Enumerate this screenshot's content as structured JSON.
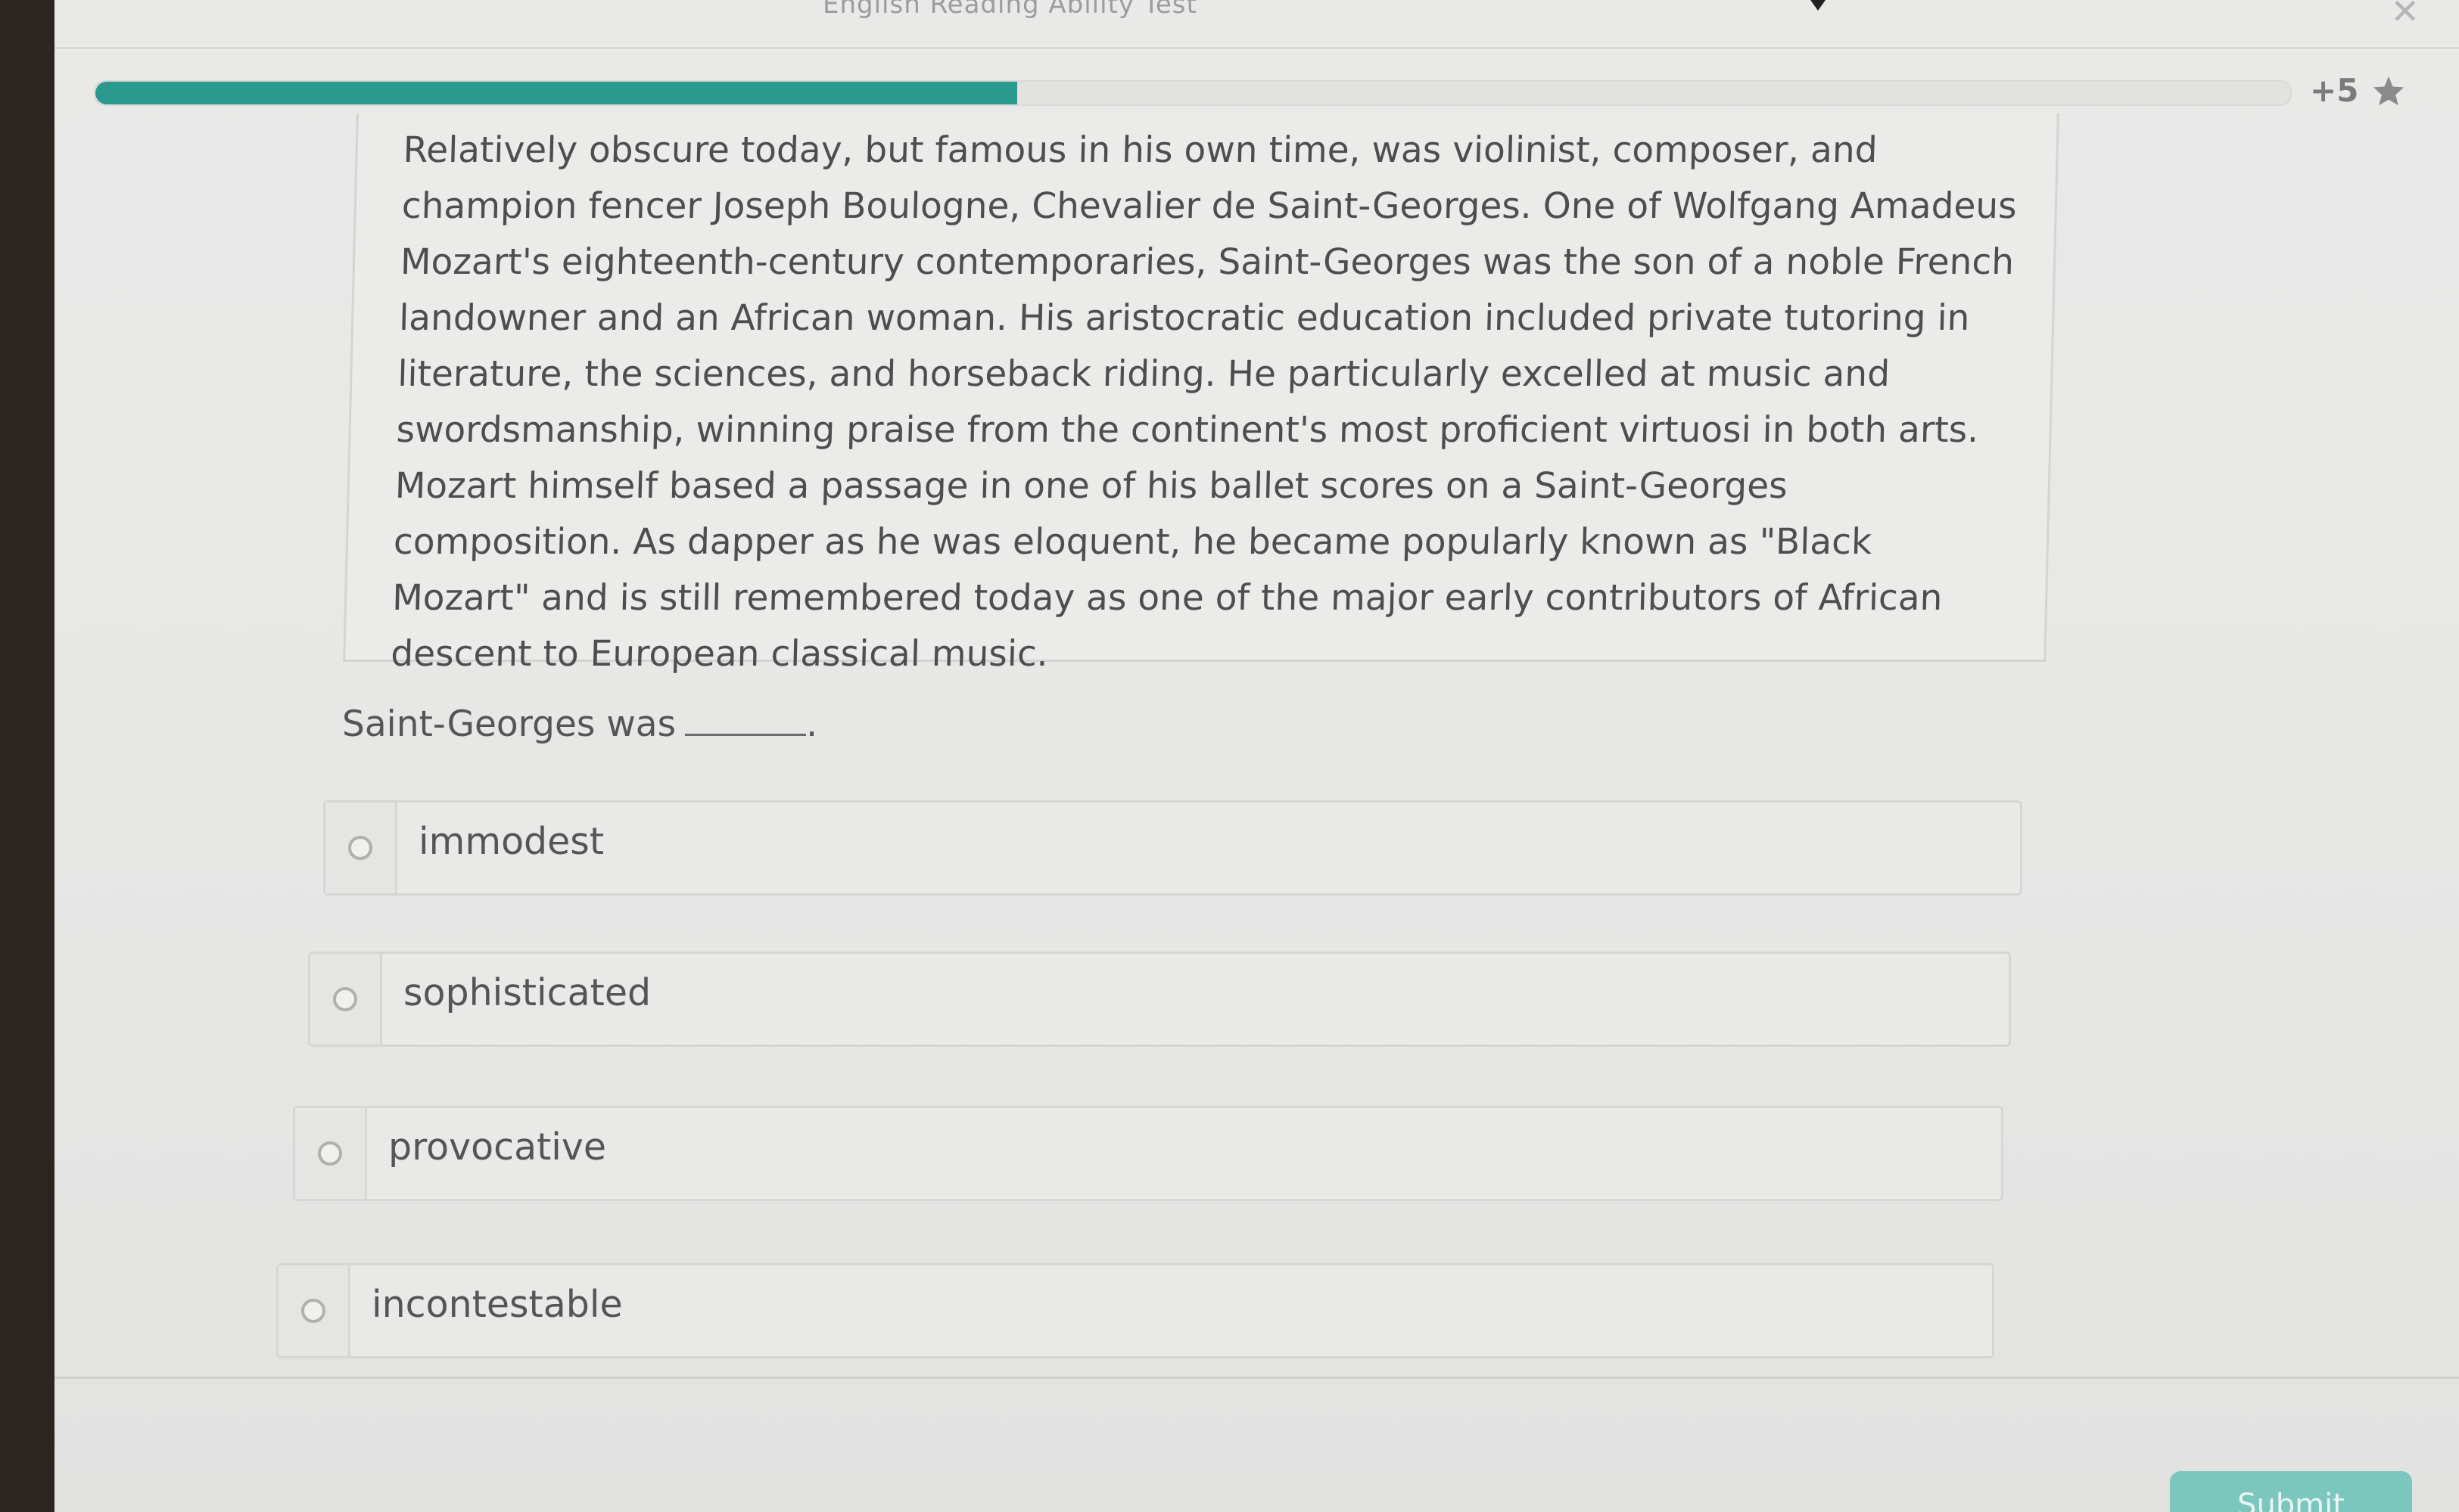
{
  "window": {
    "title": "English Reading Ability Test",
    "close_icon": "close-icon"
  },
  "progress": {
    "fraction": 0.42,
    "fill_color": "#2a9a8f",
    "points_label": "+5",
    "points_icon": "star-icon"
  },
  "passage": {
    "text": "Relatively obscure today, but famous in his own time, was violinist, composer, and champion fencer Joseph Boulogne, Chevalier de Saint-Georges. One of Wolfgang Amadeus Mozart's eighteenth-century contemporaries, Saint-Georges was the son of a noble French landowner and an African woman. His aristocratic education included private tutoring in literature, the sciences, and horseback riding. He particularly excelled at music and swordsmanship, winning praise from the continent's most proficient virtuosi in both arts. Mozart himself based a passage in one of his ballet scores on a Saint-Georges composition. As dapper as he was eloquent, he became popularly known as \"Black Mozart\" and is still remembered today as one of the major early contributors of African descent to European classical music."
  },
  "question": {
    "stem": "Saint-Georges was",
    "end_punct": "."
  },
  "options": [
    {
      "label": "immodest"
    },
    {
      "label": "sophisticated"
    },
    {
      "label": "provocative"
    },
    {
      "label": "incontestable"
    }
  ],
  "submit": {
    "label": "Submit"
  },
  "colors": {
    "accent": "#2a9a8f",
    "button": "#7bc6bd"
  }
}
